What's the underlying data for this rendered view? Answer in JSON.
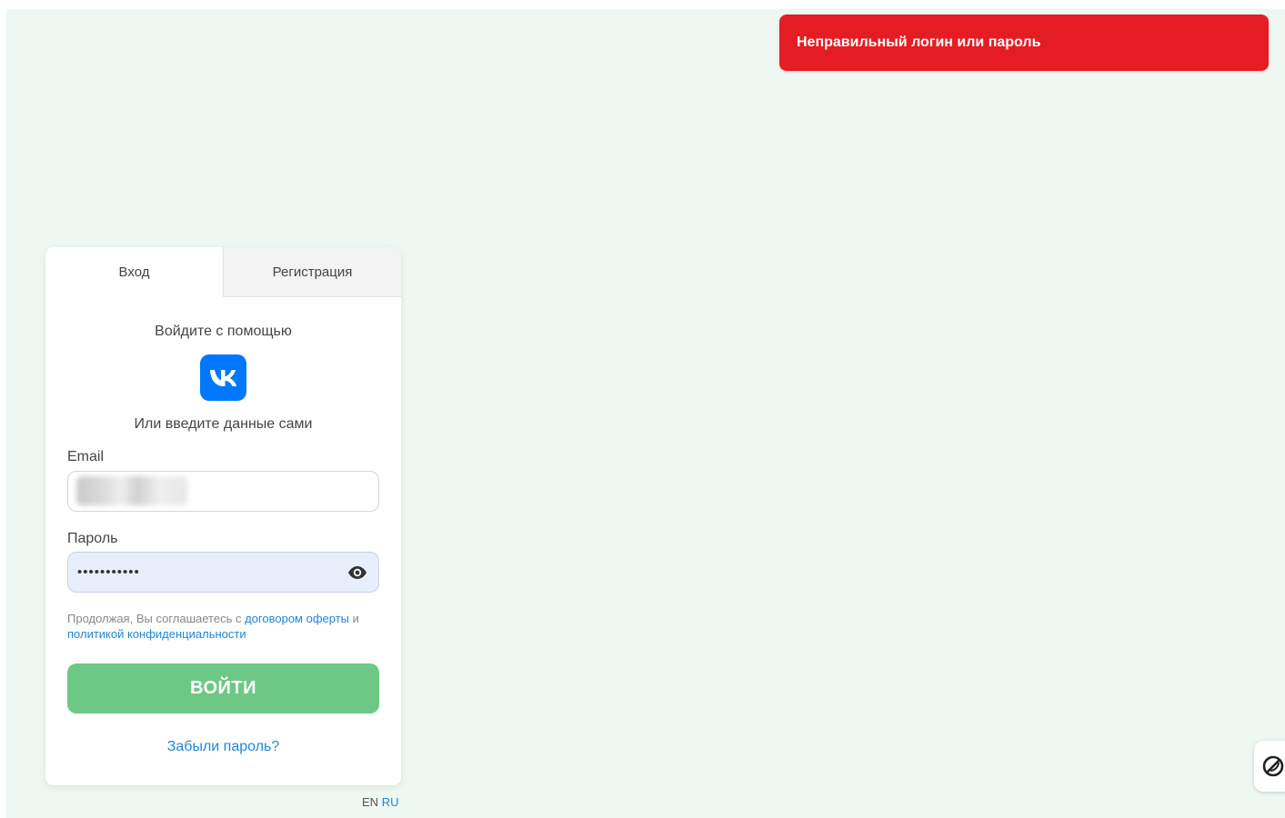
{
  "toast": {
    "message": "Неправильный логин или пароль",
    "color": "#e51c23"
  },
  "tabs": [
    {
      "label": "Вход",
      "active": true
    },
    {
      "label": "Регистрация",
      "active": false
    }
  ],
  "auth": {
    "social_title": "Войдите с помощью",
    "social_icon": "vk-icon",
    "manual_title": "Или введите данные сами"
  },
  "email": {
    "label": "Email",
    "value": ""
  },
  "password": {
    "label": "Пароль",
    "value": "•••••••••••",
    "toggle_icon": "eye-icon"
  },
  "terms": {
    "prefix": "Продолжая, Вы соглашаетесь с ",
    "offer_link": "договором оферты",
    "joiner": " и ",
    "privacy_link": "политикой конфиденциальности"
  },
  "login_button": {
    "label": "ВОЙТИ",
    "color": "#6ec885"
  },
  "forgot_link": "Забыли пароль?",
  "languages": {
    "en": "EN",
    "ru": "RU",
    "selected": "RU"
  },
  "widget": {
    "icon": "pen-circle-icon"
  },
  "colors": {
    "accent": "#2187d4",
    "background": "#eef7f1",
    "vk": "#0077ff"
  }
}
